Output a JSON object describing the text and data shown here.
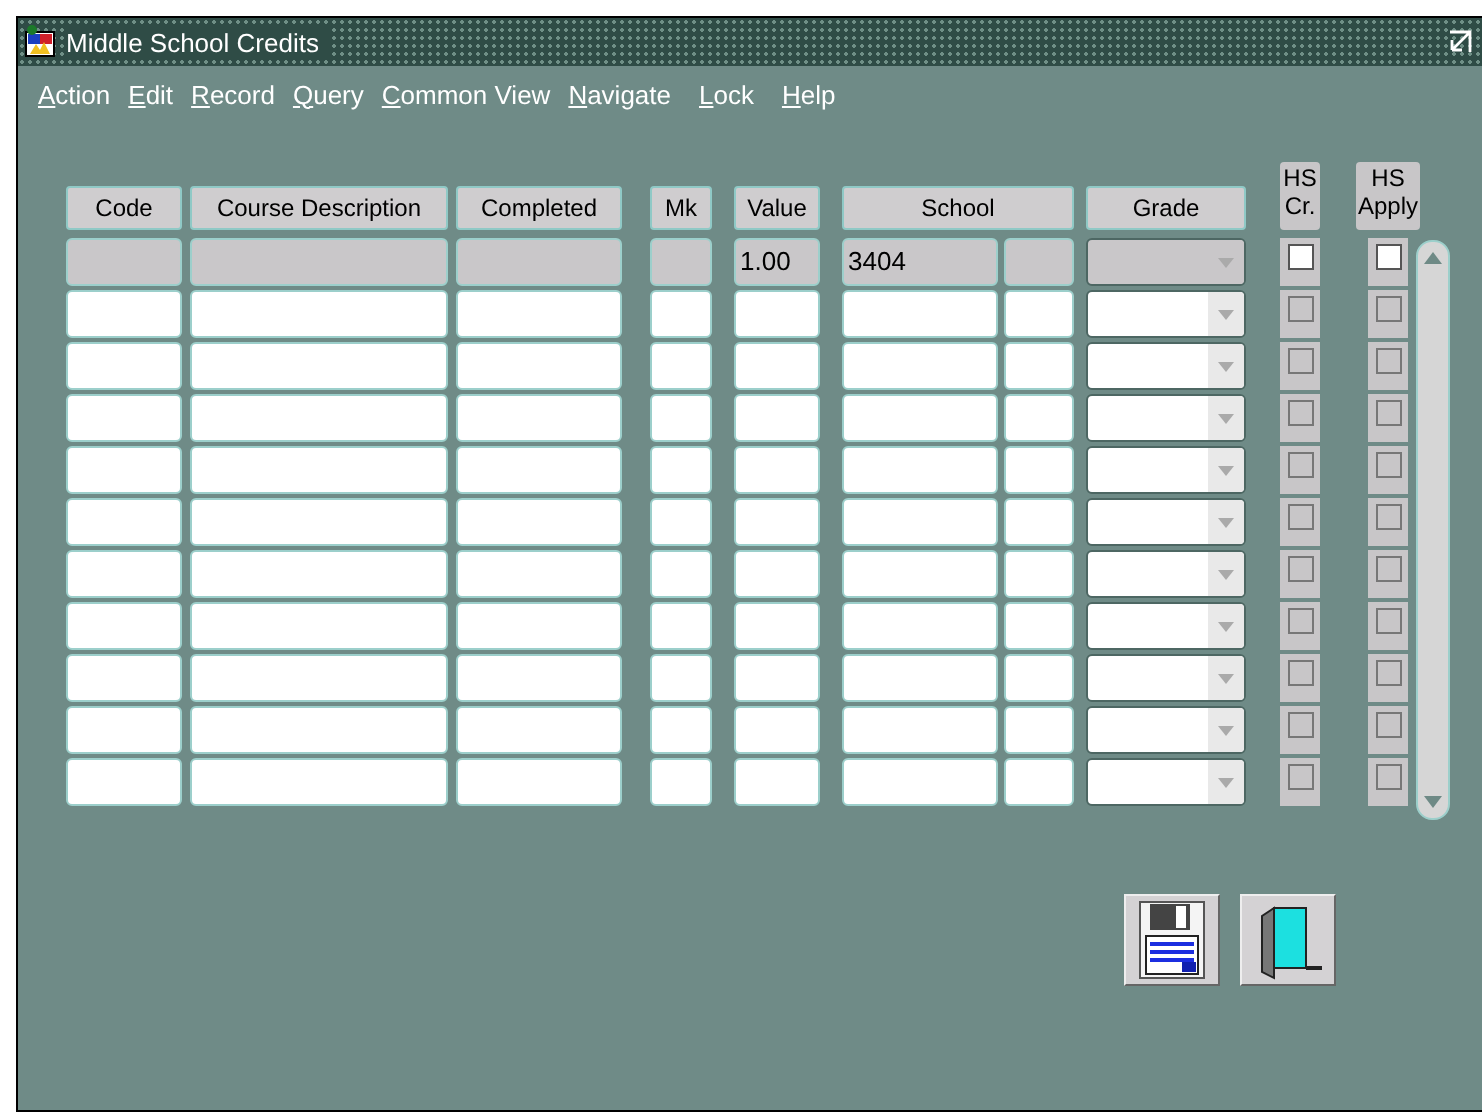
{
  "window": {
    "title": "Middle School Credits"
  },
  "menu": [
    "Action",
    "Edit",
    "Record",
    "Query",
    "Common View",
    "Navigate",
    "Lock",
    "Help"
  ],
  "columns": [
    "Code",
    "Course Description",
    "Completed",
    "Mk",
    "Value",
    "School",
    "Grade",
    "HS Cr.",
    "HS Apply"
  ],
  "rows": [
    {
      "selected": true,
      "value": "1.00",
      "school": "3404",
      "hs_credit": false,
      "hs_apply": false
    },
    {
      "selected": false,
      "hs_credit": false,
      "hs_apply": false
    },
    {
      "selected": false,
      "hs_credit": false,
      "hs_apply": false
    },
    {
      "selected": false,
      "hs_credit": false,
      "hs_apply": false
    },
    {
      "selected": false,
      "hs_credit": false,
      "hs_apply": false
    },
    {
      "selected": false,
      "hs_credit": false,
      "hs_apply": false
    },
    {
      "selected": false,
      "hs_credit": false,
      "hs_apply": false
    },
    {
      "selected": false,
      "hs_credit": false,
      "hs_apply": false
    },
    {
      "selected": false,
      "hs_credit": false,
      "hs_apply": false
    },
    {
      "selected": false,
      "hs_credit": false,
      "hs_apply": false
    },
    {
      "selected": false,
      "hs_credit": false,
      "hs_apply": false
    }
  ]
}
